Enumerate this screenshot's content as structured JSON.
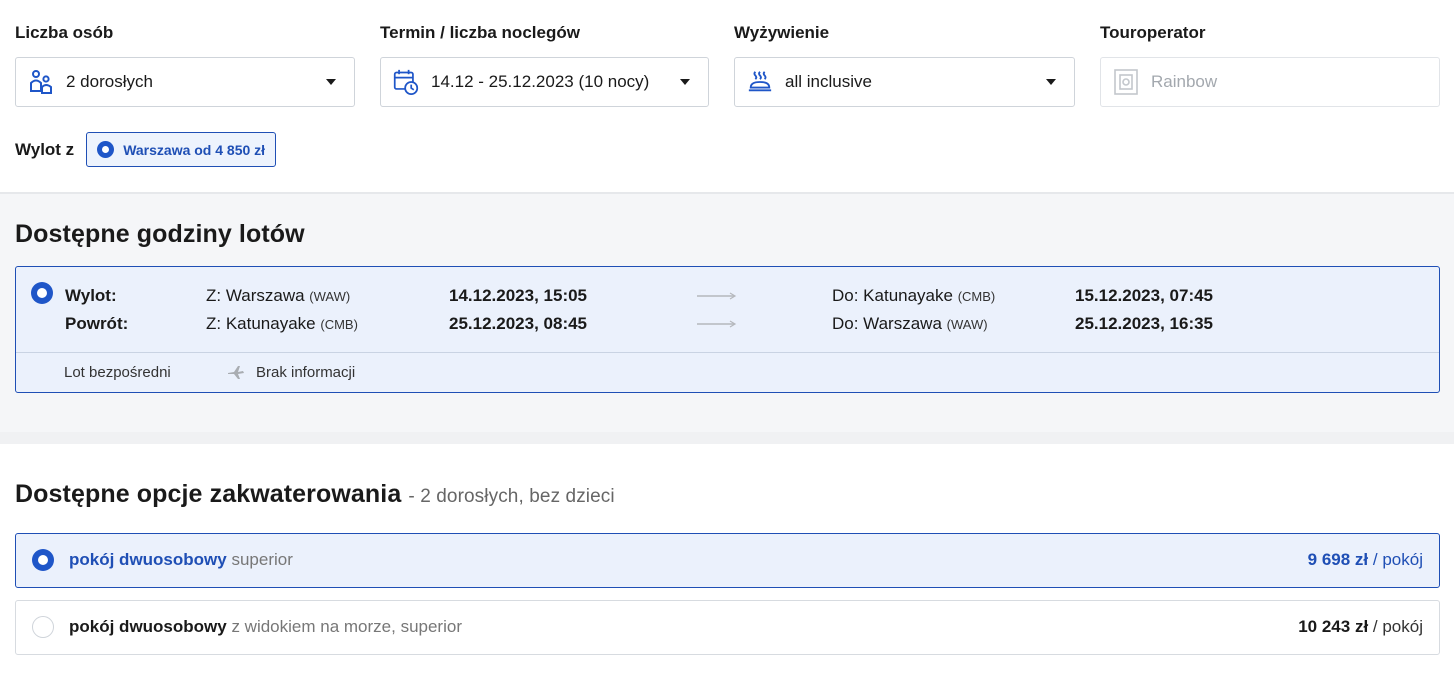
{
  "filters": {
    "persons": {
      "label": "Liczba osób",
      "value": "2 dorosłych",
      "icon": "people-icon"
    },
    "term": {
      "label": "Termin / liczba noclegów",
      "value": "14.12 - 25.12.2023 (10 nocy)",
      "icon": "calendar-clock-icon"
    },
    "board": {
      "label": "Wyżywienie",
      "value": "all inclusive",
      "icon": "food-dish-icon"
    },
    "operator": {
      "label": "Touroperator",
      "value": "Rainbow",
      "icon": "operator-logo-icon"
    }
  },
  "departure": {
    "label": "Wylot z",
    "option": "Warszawa od 4 850 zł"
  },
  "flights": {
    "title": "Dostępne godziny lotów",
    "outbound": {
      "label": "Wylot:",
      "from": "Z: Warszawa",
      "from_code": "(WAW)",
      "depart": "14.12.2023, 15:05",
      "to": "Do: Katunayake",
      "to_code": "(CMB)",
      "arrive": "15.12.2023, 07:45"
    },
    "return": {
      "label": "Powrót:",
      "from": "Z: Katunayake",
      "from_code": "(CMB)",
      "depart": "25.12.2023, 08:45",
      "to": "Do: Warszawa",
      "to_code": "(WAW)",
      "arrive": "25.12.2023, 16:35"
    },
    "footer": {
      "direct": "Lot bezpośredni",
      "info": "Brak informacji"
    }
  },
  "accommodation": {
    "title": "Dostępne opcje zakwaterowania",
    "subtitle": "- 2 dorosłych, bez dzieci",
    "rooms": [
      {
        "name": "pokój dwuosobowy",
        "desc": "superior",
        "price": "9 698 zł",
        "unit": "/ pokój",
        "selected": true
      },
      {
        "name": "pokój dwuosobowy",
        "desc": "z widokiem na morze, superior",
        "price": "10 243 zł",
        "unit": "/ pokój",
        "selected": false
      }
    ]
  },
  "colors": {
    "accent": "#1f4fb5",
    "selected_bg": "#ebf1fc",
    "section_bg": "#f5f6f8"
  }
}
